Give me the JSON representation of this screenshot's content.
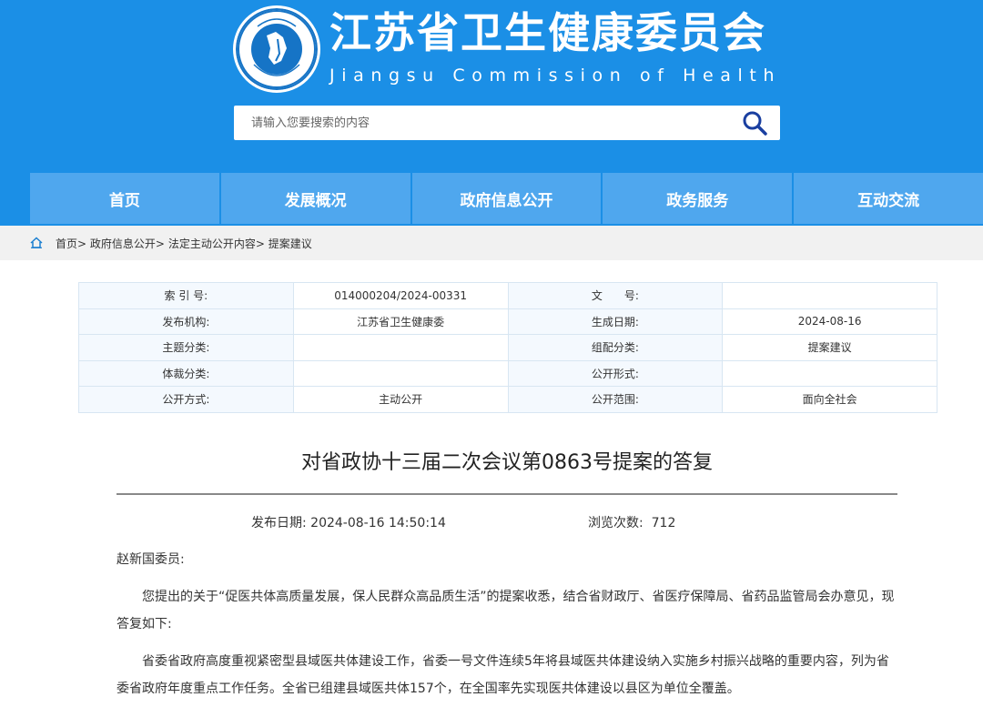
{
  "header": {
    "title": "江苏省卫生健康委员会",
    "subtitle": "Jiangsu Commission of Health",
    "logo_text": "Jiangsu Commission of Health",
    "bg_color": "#1b8fe6",
    "nav_color": "#4fa7ee"
  },
  "search": {
    "placeholder": "请输入您要搜索的内容",
    "icon": "search-icon"
  },
  "nav": {
    "items": [
      {
        "label": "首页"
      },
      {
        "label": "发展概况"
      },
      {
        "label": "政府信息公开"
      },
      {
        "label": "政务服务"
      },
      {
        "label": "互动交流"
      }
    ]
  },
  "breadcrumb": {
    "icon": "home-icon",
    "items": [
      "首页",
      "政府信息公开",
      "法定主动公开内容",
      "提案建议"
    ],
    "separator": ">"
  },
  "meta": {
    "rows": [
      {
        "label1": "索 引 号:",
        "value1": "014000204/2024-00331",
        "label2": "文　　号:",
        "value2": ""
      },
      {
        "label1": "发布机构:",
        "value1": "江苏省卫生健康委",
        "label2": "生成日期:",
        "value2": "2024-08-16"
      },
      {
        "label1": "主题分类:",
        "value1": "",
        "label2": "组配分类:",
        "value2": "提案建议"
      },
      {
        "label1": "体裁分类:",
        "value1": "",
        "label2": "公开形式:",
        "value2": ""
      },
      {
        "label1": "公开方式:",
        "value1": "主动公开",
        "label2": "公开范围:",
        "value2": "面向全社会"
      }
    ]
  },
  "article": {
    "title": "对省政协十三届二次会议第0863号提案的答复",
    "publish_label": "发布日期:",
    "publish_date": "2024-08-16 14:50:14",
    "views_label": "浏览次数:",
    "views": "712",
    "greeting": "赵新国委员:",
    "paragraphs": [
      "您提出的关于“促医共体高质量发展，保人民群众高品质生活”的提案收悉，结合省财政厅、省医疗保障局、省药品监管局会办意见，现答复如下:",
      "省委省政府高度重视紧密型县域医共体建设工作，省委一号文件连续5年将县域医共体建设纳入实施乡村振兴战略的重要内容，列为省委省政府年度重点工作任务。全省已组建县域医共体157个，在全国率先实现医共体建设以县区为单位全覆盖。"
    ]
  }
}
